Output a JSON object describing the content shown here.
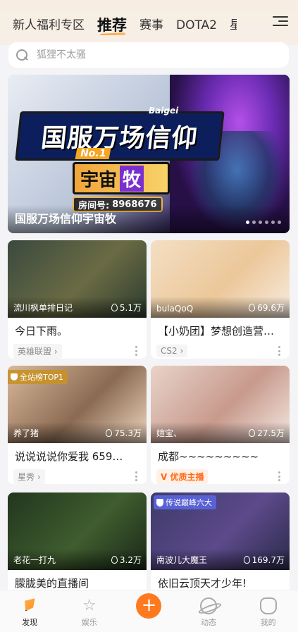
{
  "header": {
    "tabs": [
      {
        "label": "新人福利专区",
        "active": false
      },
      {
        "label": "推荐",
        "active": true
      },
      {
        "label": "赛事",
        "active": false
      },
      {
        "label": "DOTA2",
        "active": false
      },
      {
        "label": "星",
        "active": false
      }
    ],
    "menu_icon": "menu-icon"
  },
  "search": {
    "placeholder": "狐狸不太骚"
  },
  "banner": {
    "art_title": "国服万场信仰",
    "art_badge": "No.1",
    "art_brand": "Baigei",
    "art_sub_a": "宇宙",
    "art_sub_b": "牧",
    "art_room_label": "房间号:",
    "art_room_number": "8968676",
    "caption": "国服万场信仰宇宙牧",
    "dots_total": 6,
    "dots_active_index": 0
  },
  "cards": [
    {
      "streamer": "流川枫单排日记",
      "views": "5.1万",
      "title": "今日下雨。",
      "category": "英雄联盟",
      "badge": null,
      "colors": [
        "#3a4a3e",
        "#6a6b44",
        "#2c3b2d"
      ]
    },
    {
      "streamer": "bulaQoQ",
      "views": "69.6万",
      "title": "【小奶团】梦想创造营…",
      "category": "CS2",
      "badge": null,
      "colors": [
        "#f3dfc3",
        "#ecc79a",
        "#f8ece0"
      ]
    },
    {
      "streamer": "养了猪",
      "views": "75.3万",
      "title": "说说说说你爱我 659…",
      "category": "星秀",
      "badge": {
        "type": "rank",
        "label": "全站榜TOP1"
      },
      "colors": [
        "#d9b89a",
        "#8a6a52",
        "#f0d7c0"
      ]
    },
    {
      "streamer": "媗宝、",
      "views": "27.5万",
      "title": "成都~~~~~~~~~",
      "category": "优质主播",
      "category_style": "quality",
      "badge": null,
      "colors": [
        "#e9d3c9",
        "#c79a8c",
        "#f5e8e2"
      ]
    },
    {
      "streamer": "老花一打九",
      "views": "3.2万",
      "title": "朦胧美的直播间",
      "category": "",
      "badge": null,
      "colors": [
        "#23361e",
        "#3f5d2f",
        "#1a2817"
      ]
    },
    {
      "streamer": "南波儿大魔王",
      "views": "169.7万",
      "title": "依旧云顶天才少年!",
      "category": "",
      "badge": {
        "type": "legend",
        "label": "传说巅峰六大"
      },
      "colors": [
        "#3d3b6a",
        "#5c4a8a",
        "#2a2a4a"
      ]
    }
  ],
  "bottom_nav": [
    {
      "label": "发现",
      "icon": "discover-icon",
      "active": true
    },
    {
      "label": "娱乐",
      "icon": "star-icon",
      "active": false
    },
    {
      "label": "",
      "icon": "plus-icon",
      "active": false
    },
    {
      "label": "动态",
      "icon": "planet-icon",
      "active": false
    },
    {
      "label": "我的",
      "icon": "profile-icon",
      "active": false
    }
  ],
  "colors": {
    "accent": "#ff7a1e",
    "tab_underline": "#ff9a2e",
    "quality_tag": "#ff6a1a"
  }
}
